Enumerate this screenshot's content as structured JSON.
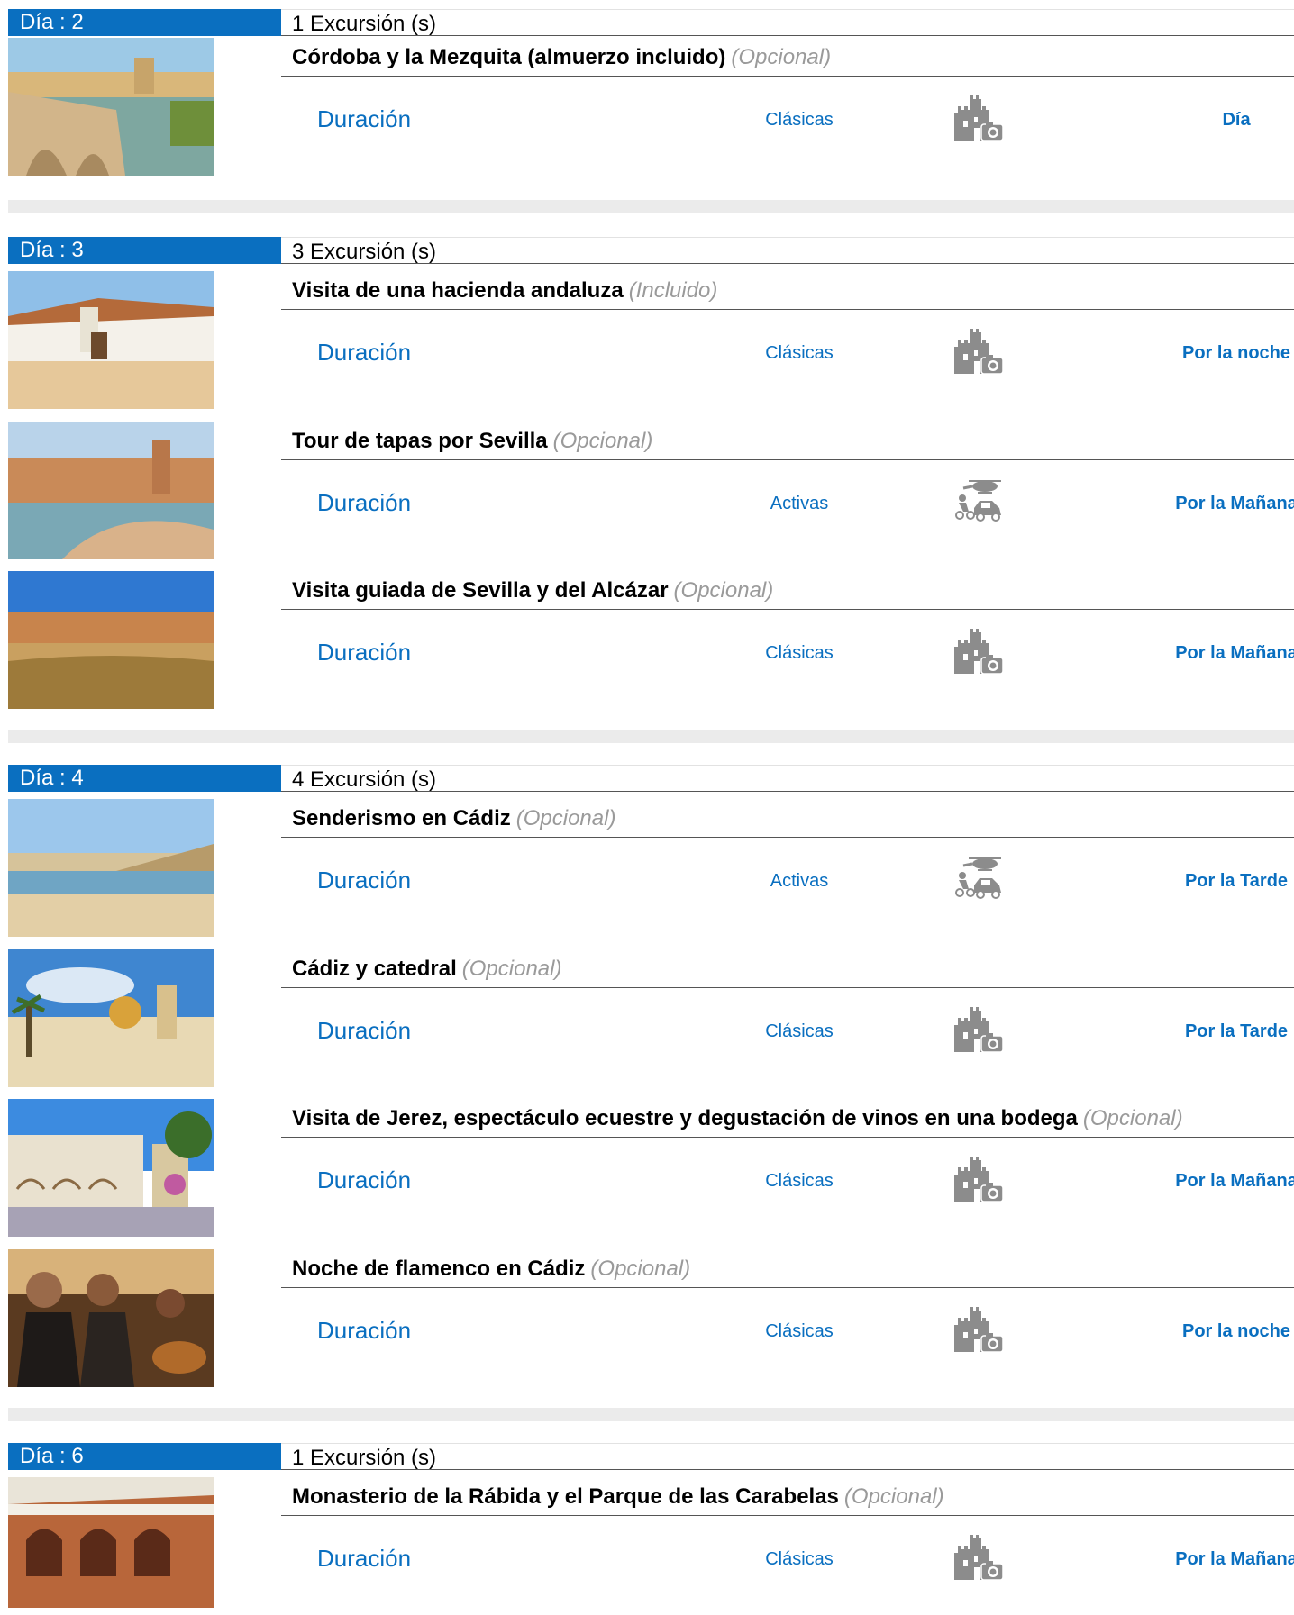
{
  "days": [
    {
      "label": "Día : 2",
      "count": "1 Excursión (s)",
      "excursions": [
        {
          "title": "Córdoba y la Mezquita (almuerzo incluido)",
          "tag": "(Opcional)",
          "duration": "Duración",
          "category": "Clásicas",
          "icon": "castle-camera-icon",
          "time": "Día"
        }
      ]
    },
    {
      "label": "Día : 3",
      "count": "3 Excursión (s)",
      "excursions": [
        {
          "title": "Visita de una hacienda andaluza",
          "tag": "(Incluido)",
          "duration": "Duración",
          "category": "Clásicas",
          "icon": "castle-camera-icon",
          "time": "Por la noche"
        },
        {
          "title": "Tour de tapas por Sevilla",
          "tag": "(Opcional)",
          "duration": "Duración",
          "category": "Activas",
          "icon": "active-sports-icon",
          "time": "Por la Mañana"
        },
        {
          "title": "Visita guiada de Sevilla y del Alcázar",
          "tag": "(Opcional)",
          "duration": "Duración",
          "category": "Clásicas",
          "icon": "castle-camera-icon",
          "time": "Por la Mañana"
        }
      ]
    },
    {
      "label": "Día : 4",
      "count": "4 Excursión (s)",
      "excursions": [
        {
          "title": "Senderismo en Cádiz",
          "tag": "(Opcional)",
          "duration": "Duración",
          "category": "Activas",
          "icon": "active-sports-icon",
          "time": "Por la Tarde"
        },
        {
          "title": "Cádiz y catedral",
          "tag": "(Opcional)",
          "duration": "Duración",
          "category": "Clásicas",
          "icon": "castle-camera-icon",
          "time": "Por la Tarde"
        },
        {
          "title": "Visita de Jerez, espectáculo ecuestre y degustación de vinos en una bodega",
          "tag": "(Opcional)",
          "duration": "Duración",
          "category": "Clásicas",
          "icon": "castle-camera-icon",
          "time": "Por la Mañana"
        },
        {
          "title": "Noche de flamenco en Cádiz",
          "tag": "(Opcional)",
          "duration": "Duración",
          "category": "Clásicas",
          "icon": "castle-camera-icon",
          "time": "Por la noche"
        }
      ]
    },
    {
      "label": "Día : 6",
      "count": "1 Excursión (s)",
      "excursions": [
        {
          "title": "Monasterio de la Rábida y el Parque de las Carabelas",
          "tag": "(Opcional)",
          "duration": "Duración",
          "category": "Clásicas",
          "icon": "castle-camera-icon",
          "time": "Por la Mañana"
        }
      ]
    }
  ],
  "colors": {
    "accent": "#0a6fc0",
    "tag": "#9a9a9a",
    "separator": "#ebebeb",
    "icon": "#8c8c8c"
  }
}
